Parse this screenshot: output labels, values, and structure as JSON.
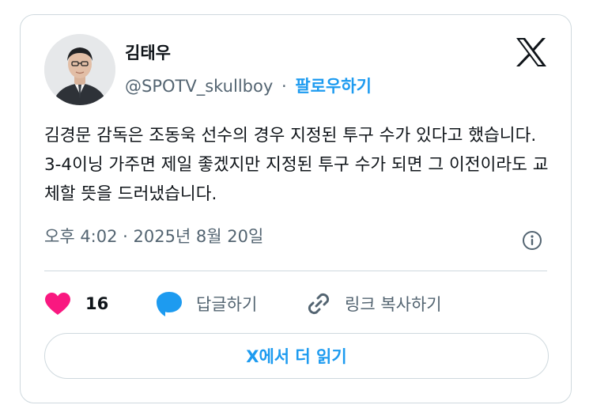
{
  "author": {
    "name": "김태우",
    "handle": "@SPOTV_skullboy",
    "separator": "·",
    "follow_label": "팔로우하기"
  },
  "icons": {
    "brand": "x-logo-icon",
    "info": "info-icon",
    "like": "heart-icon",
    "reply": "speech-bubble-icon",
    "copy": "link-icon"
  },
  "tweet": {
    "text": "김경문 감독은 조동욱 선수의 경우 지정된 투구 수가 있다고 했습니다. 3-4이닝 가주면 제일 좋겠지만 지정된 투구 수가 되면 그 이전이라도 교체할 뜻을 드러냈습니다.",
    "timestamp": "오후 4:02 · 2025년 8월 20일"
  },
  "actions": {
    "like_count": "16",
    "reply_label": "답글하기",
    "copy_label": "링크 복사하기"
  },
  "read_more_label": "X에서 더 읽기",
  "colors": {
    "accent": "#1d9bf0",
    "like": "#f91880",
    "text": "#0f1419",
    "muted": "#536471",
    "border": "#cfd9de"
  }
}
